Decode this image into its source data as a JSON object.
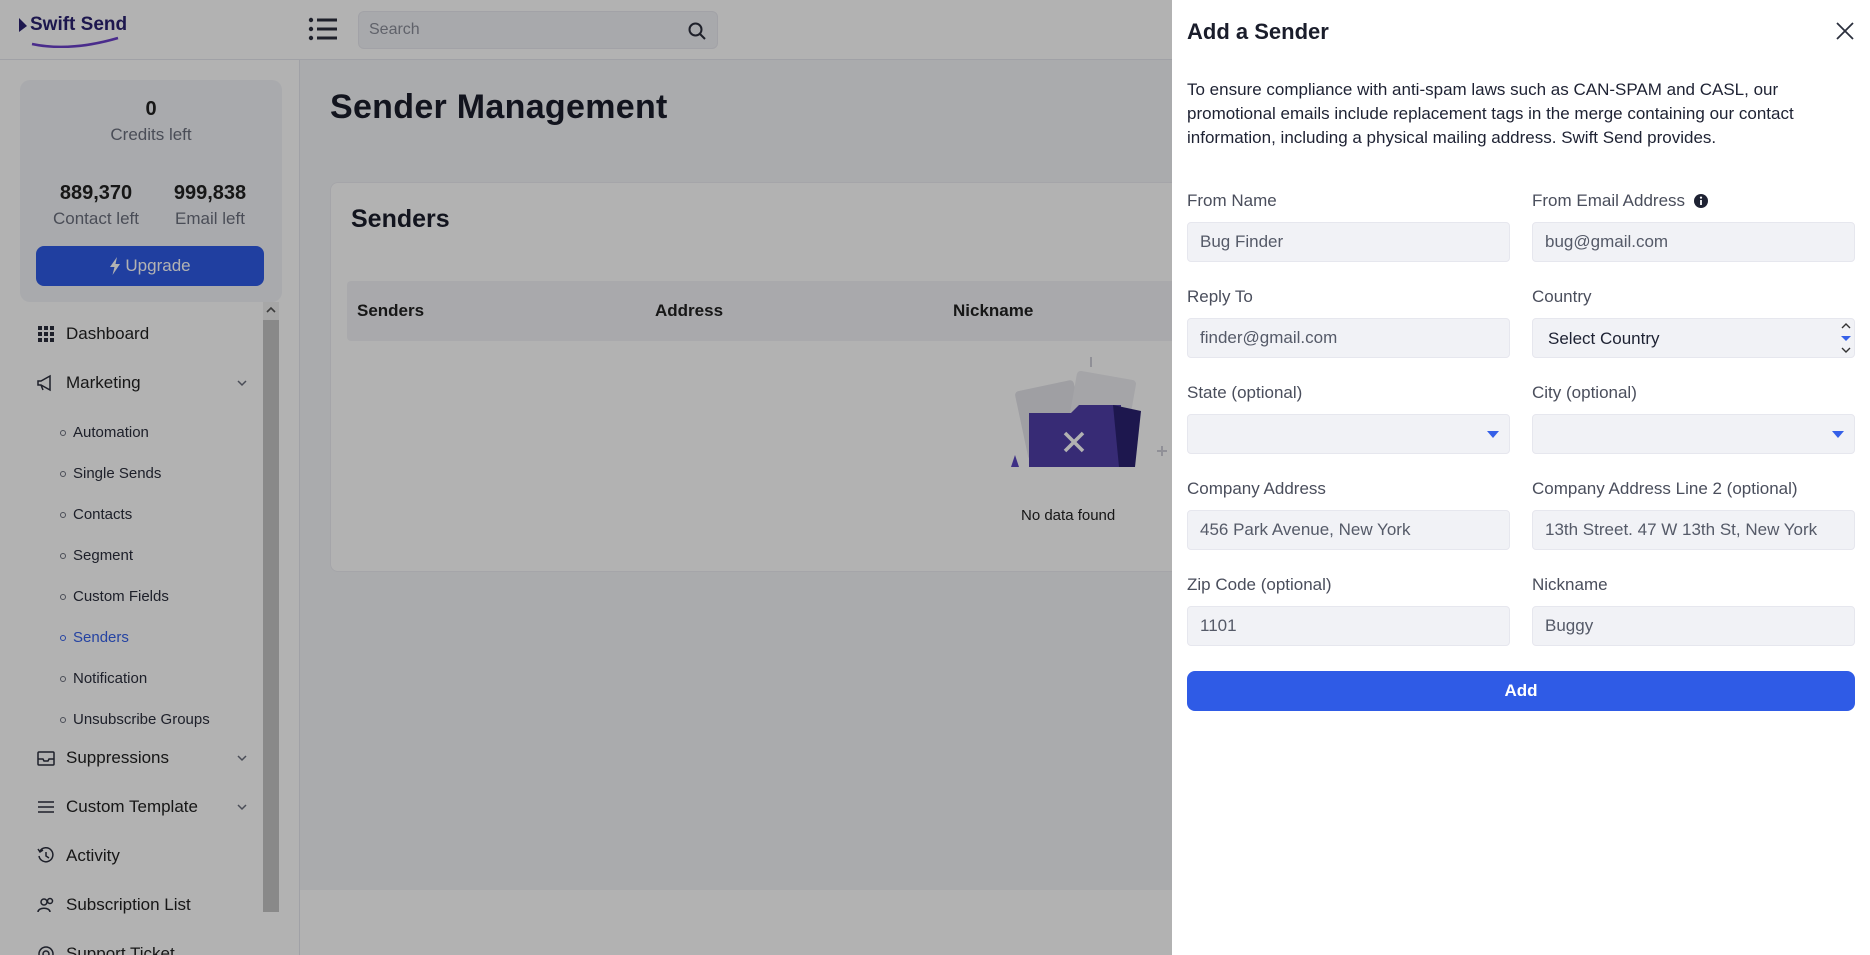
{
  "header": {
    "logo_text": "Swift Send",
    "search_placeholder": "Search"
  },
  "sidebar": {
    "credits": {
      "value": "0",
      "label": "Credits left"
    },
    "contacts": {
      "value": "889,370",
      "label": "Contact left"
    },
    "emails": {
      "value": "999,838",
      "label": "Email left"
    },
    "upgrade_label": "Upgrade",
    "items": {
      "dashboard": "Dashboard",
      "marketing": "Marketing",
      "suppressions": "Suppressions",
      "custom_template": "Custom Template",
      "activity": "Activity",
      "subscription_list": "Subscription List",
      "support_ticket": "Support Ticket"
    },
    "marketing_sub": [
      "Automation",
      "Single Sends",
      "Contacts",
      "Segment",
      "Custom Fields",
      "Senders",
      "Notification",
      "Unsubscribe Groups"
    ],
    "active_sub": "Senders"
  },
  "main": {
    "page_title": "Sender Management",
    "card_title": "Senders",
    "columns": [
      "Senders",
      "Address",
      "Nickname"
    ],
    "empty_text": "No data found"
  },
  "drawer": {
    "title": "Add a Sender",
    "description": "To ensure compliance with anti-spam laws such as CAN-SPAM and CASL, our promotional emails include replacement tags in the merge containing our contact information, including a physical mailing address. Swift Send provides.",
    "fields": {
      "from_name": {
        "label": "From Name",
        "value": "Bug Finder"
      },
      "from_email": {
        "label": "From Email Address",
        "value": "bug@gmail.com"
      },
      "reply_to": {
        "label": "Reply To",
        "value": "finder@gmail.com"
      },
      "country": {
        "label": "Country",
        "value": "Select Country"
      },
      "state": {
        "label": "State (optional)",
        "value": ""
      },
      "city": {
        "label": "City (optional)",
        "value": ""
      },
      "company_address": {
        "label": "Company Address",
        "value": "456 Park Avenue, New York"
      },
      "company_address_2": {
        "label": "Company Address Line 2 (optional)",
        "value": "13th Street. 47 W 13th St, New York"
      },
      "zip": {
        "label": "Zip Code (optional)",
        "value": "1101"
      },
      "nickname": {
        "label": "Nickname",
        "value": "Buggy"
      }
    },
    "submit_label": "Add"
  },
  "colors": {
    "primary": "#2f5be6",
    "active_link": "#3560e8",
    "brand": "#2a2270"
  }
}
